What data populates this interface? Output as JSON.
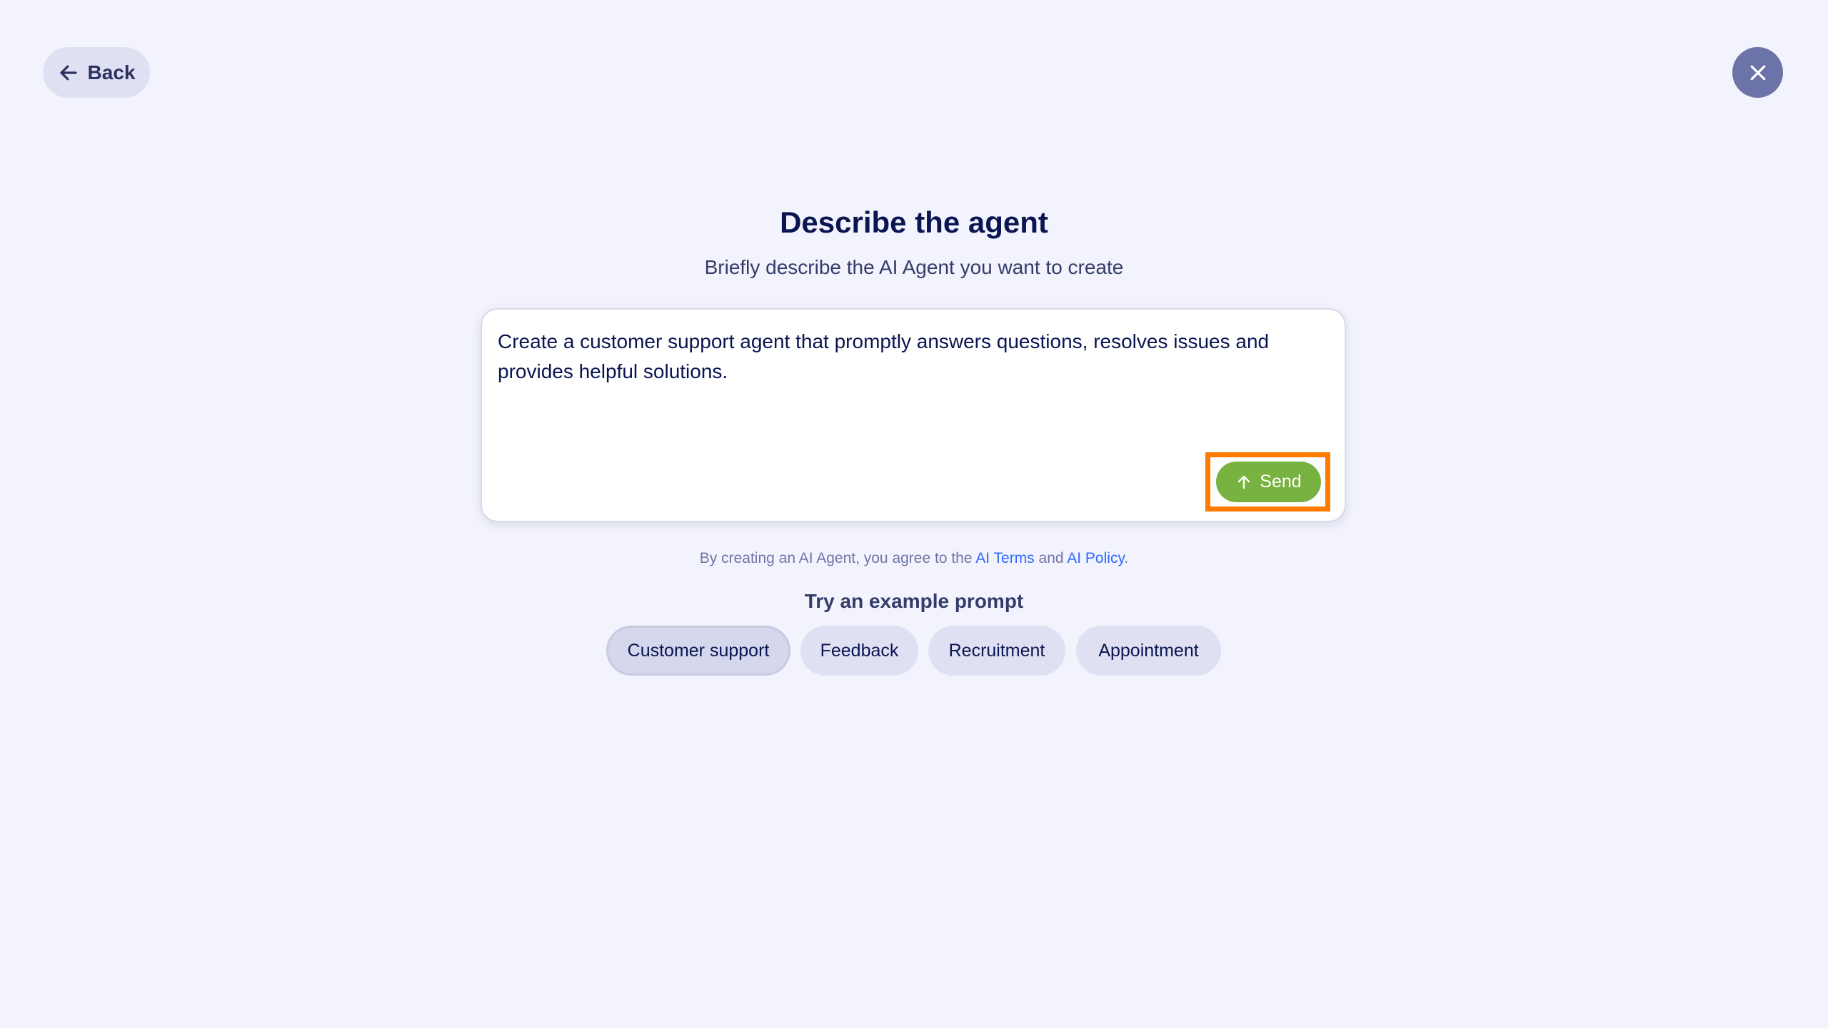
{
  "header": {
    "back_label": "Back",
    "back_icon": "arrow-left-icon",
    "close_icon": "close-icon"
  },
  "main": {
    "title": "Describe the agent",
    "subtitle": "Briefly describe the AI Agent you want to create",
    "prompt": {
      "value": "Create a customer support agent that promptly answers questions, resolves issues and provides helpful solutions.",
      "send_label": "Send",
      "send_icon": "arrow-up-icon"
    },
    "legal": {
      "prefix": "By creating an AI Agent, you agree to the ",
      "terms_link": "AI Terms",
      "middle": " and ",
      "policy_link": "AI Policy",
      "suffix": "."
    },
    "examples": {
      "heading": "Try an example prompt",
      "items": [
        {
          "label": "Customer support",
          "selected": true
        },
        {
          "label": "Feedback",
          "selected": false
        },
        {
          "label": "Recruitment",
          "selected": false
        },
        {
          "label": "Appointment",
          "selected": false
        }
      ]
    }
  },
  "colors": {
    "background": "#f2f3fc",
    "send_button": "#78b240",
    "highlight": "#ff7a00",
    "link": "#2e69ff",
    "close_button": "#6c73a8"
  }
}
